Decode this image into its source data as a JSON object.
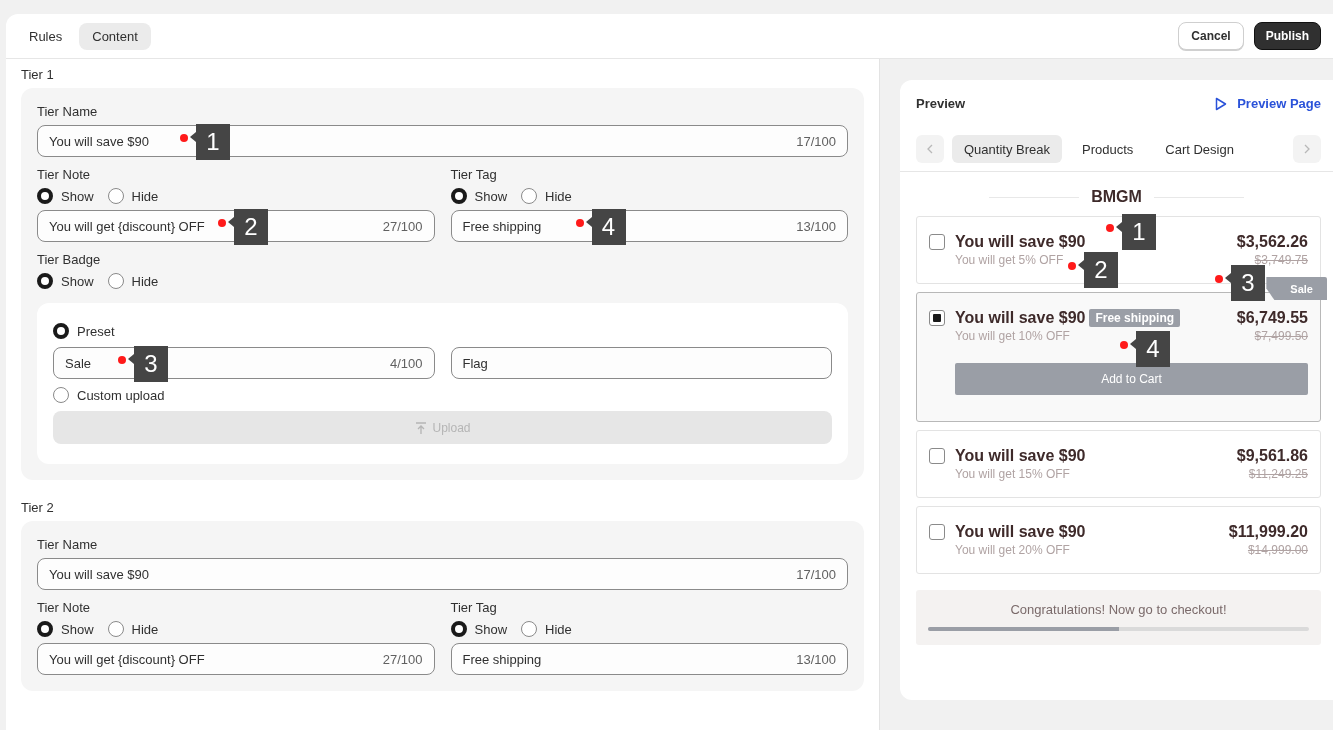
{
  "tabs": [
    {
      "label": "Rules",
      "selected": false
    },
    {
      "label": "Content",
      "selected": true
    }
  ],
  "actions": {
    "cancel": "Cancel",
    "publish": "Publish"
  },
  "tiers": [
    {
      "title": "Tier 1",
      "name": {
        "label": "Tier Name",
        "value": "You will save $90",
        "count": "17/100",
        "marker": "1"
      },
      "note": {
        "label": "Tier Note",
        "options": [
          {
            "label": "Show",
            "selected": true
          },
          {
            "label": "Hide",
            "selected": false
          }
        ],
        "value": "You will get {discount} OFF",
        "count": "27/100",
        "marker": "2"
      },
      "tag": {
        "label": "Tier Tag",
        "options": [
          {
            "label": "Show",
            "selected": true
          },
          {
            "label": "Hide",
            "selected": false
          }
        ],
        "value": "Free shipping",
        "count": "13/100",
        "marker": "4"
      },
      "badge": {
        "label": "Tier Badge",
        "options": [
          {
            "label": "Show",
            "selected": true
          },
          {
            "label": "Hide",
            "selected": false
          }
        ],
        "preset": {
          "label": "Preset",
          "selected": true,
          "value": "Sale",
          "count": "4/100",
          "marker": "3",
          "style": "Flag"
        },
        "custom": {
          "label": "Custom upload",
          "selected": false
        },
        "upload": "Upload"
      }
    },
    {
      "title": "Tier 2",
      "name": {
        "label": "Tier Name",
        "value": "You will save $90",
        "count": "17/100"
      },
      "note": {
        "label": "Tier Note",
        "options": [
          {
            "label": "Show",
            "selected": true
          },
          {
            "label": "Hide",
            "selected": false
          }
        ],
        "value": "You will get {discount} OFF",
        "count": "27/100"
      },
      "tag": {
        "label": "Tier Tag",
        "options": [
          {
            "label": "Show",
            "selected": true
          },
          {
            "label": "Hide",
            "selected": false
          }
        ],
        "value": "Free shipping",
        "count": "13/100"
      }
    }
  ],
  "preview": {
    "title": "Preview",
    "link": "Preview Page",
    "tabs": [
      {
        "label": "Quantity Break",
        "selected": true
      },
      {
        "label": "Products",
        "selected": false
      },
      {
        "label": "Cart Design",
        "selected": false
      }
    ],
    "heading": "BMGM",
    "offers": [
      {
        "title": "You will save $90",
        "note": "You will get 5% OFF",
        "price": "$3,562.26",
        "original": "$3,749.75",
        "checked": false,
        "title_marker": "1",
        "note_marker": "2"
      },
      {
        "title": "You will save $90",
        "tag": "Free shipping",
        "badge": "Sale",
        "note": "You will get 10% OFF",
        "price": "$6,749.55",
        "original": "$7,499.50",
        "checked": true,
        "button": "Add to Cart",
        "badge_marker": "3",
        "tag_marker": "4"
      },
      {
        "title": "You will save $90",
        "note": "You will get 15% OFF",
        "price": "$9,561.86",
        "original": "$11,249.25",
        "checked": false
      },
      {
        "title": "You will save $90",
        "note": "You will get 20% OFF",
        "price": "$11,999.20",
        "original": "$14,999.00",
        "checked": false
      }
    ],
    "progress": {
      "text": "Congratulations! Now go to checkout!",
      "level": 0.5
    }
  }
}
